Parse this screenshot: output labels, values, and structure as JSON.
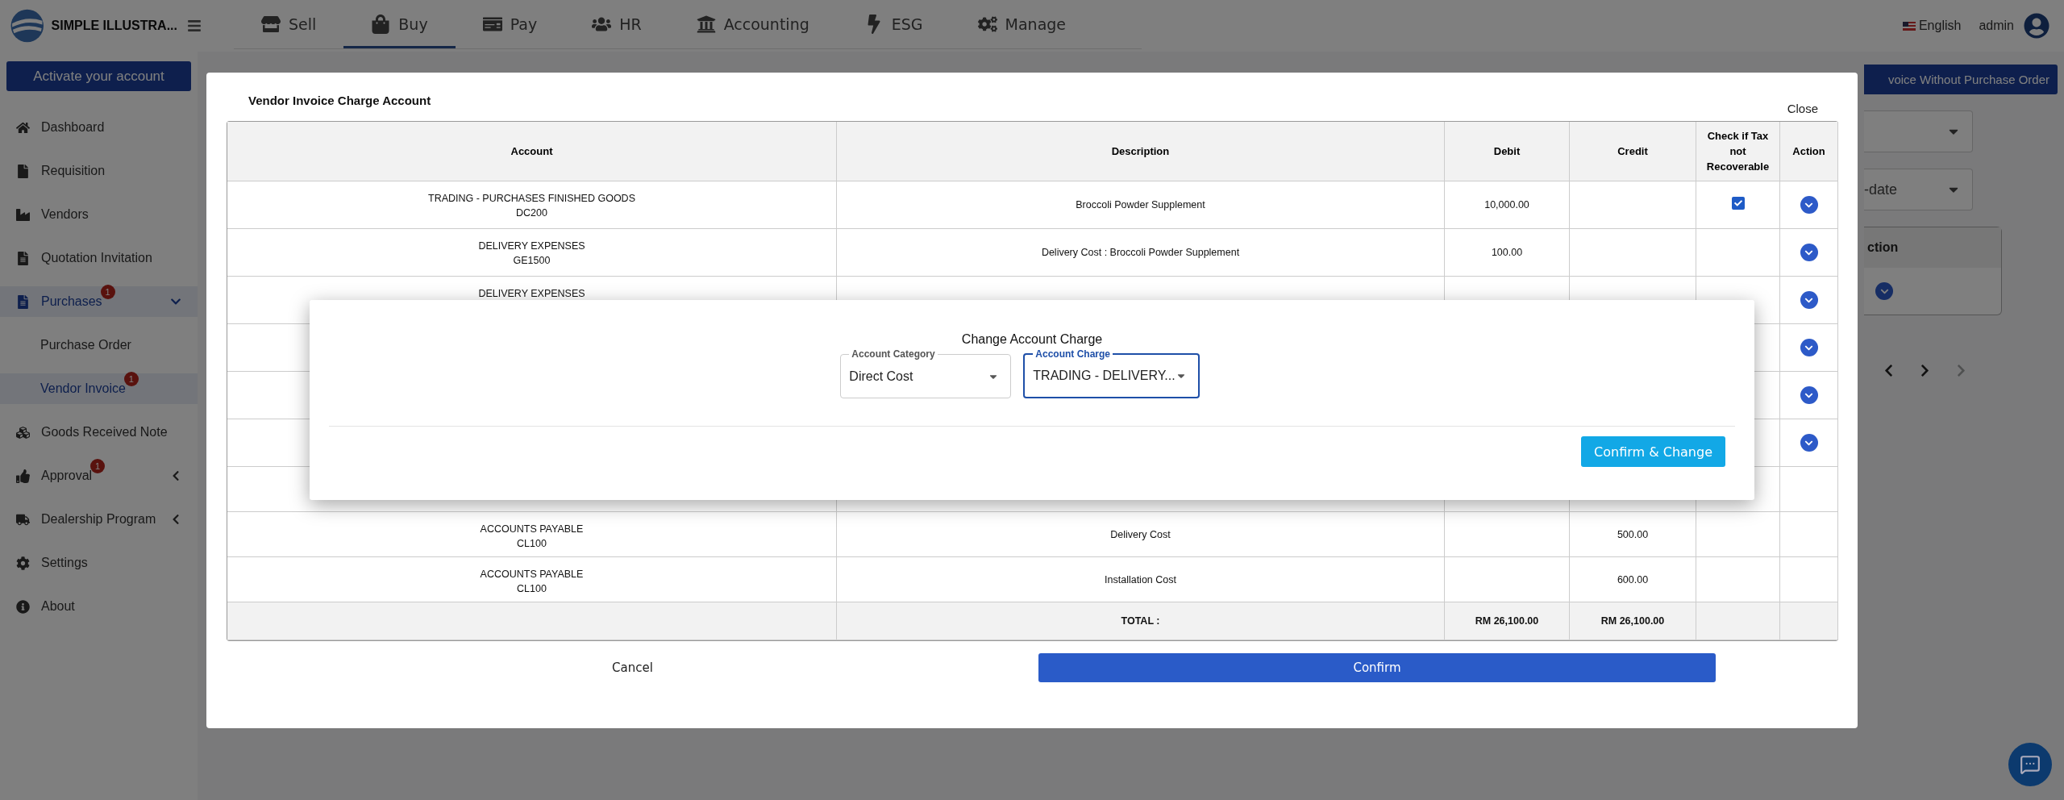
{
  "brand": {
    "name": "SIMPLE ILLUSTRA..."
  },
  "nav": [
    {
      "label": "Sell",
      "selected": false
    },
    {
      "label": "Buy",
      "selected": true
    },
    {
      "label": "Pay",
      "selected": false
    },
    {
      "label": "HR",
      "selected": false
    },
    {
      "label": "Accounting",
      "selected": false
    },
    {
      "label": "ESG",
      "selected": false
    },
    {
      "label": "Manage",
      "selected": false
    }
  ],
  "language": "English",
  "user": "admin",
  "activate_button": "Activate your account",
  "sidebar": {
    "items": [
      {
        "label": "Dashboard",
        "selected": false
      },
      {
        "label": "Requisition",
        "selected": false
      },
      {
        "label": "Vendors",
        "selected": false
      },
      {
        "label": "Quotation Invitation",
        "selected": false
      },
      {
        "label": "Purchases",
        "selected": true,
        "badge": "1",
        "expanded": true,
        "children": [
          {
            "label": "Purchase Order",
            "selected": false
          },
          {
            "label": "Vendor Invoice",
            "selected": true,
            "badge": "1"
          }
        ]
      },
      {
        "label": "Goods Received Note",
        "selected": false
      },
      {
        "label": "Approval",
        "selected": false,
        "badge": "1",
        "expanded": false
      },
      {
        "label": "Dealership Program",
        "selected": false,
        "expanded": false
      },
      {
        "label": "Settings",
        "selected": false
      },
      {
        "label": "About",
        "selected": false
      }
    ]
  },
  "background": {
    "action_button": "voice Without Purchase Order",
    "filter_value": "-date",
    "table_header": "ction"
  },
  "modal": {
    "title": "Vendor Invoice Charge Account",
    "close": "Close",
    "columns": [
      "Account",
      "Description",
      "Debit",
      "Credit",
      "Check if Tax not Recoverable",
      "Action"
    ],
    "rows": [
      {
        "account": "TRADING - PURCHASES FINISHED GOODS",
        "code": "DC200",
        "description": "Broccoli Powder Supplement",
        "debit": "10,000.00",
        "checked": true,
        "action": true
      },
      {
        "account": "DELIVERY EXPENSES",
        "code": "GE1500",
        "description": "Delivery Cost : Broccoli Powder Supplement",
        "debit": "100.00",
        "action": true
      },
      {
        "account": "DELIVERY EXPENSES",
        "action": true
      },
      {
        "action": true
      },
      {
        "action": true
      },
      {
        "action": true
      },
      {
        "action": false
      },
      {
        "account": "ACCOUNTS PAYABLE",
        "code": "CL100",
        "description": "Delivery Cost",
        "credit": "500.00",
        "action": false
      },
      {
        "account": "ACCOUNTS PAYABLE",
        "code": "CL100",
        "description": "Installation Cost",
        "credit": "600.00",
        "action": false
      }
    ],
    "total": {
      "label": "TOTAL :",
      "debit": "RM 26,100.00",
      "credit": "RM 26,100.00"
    },
    "cancel": "Cancel",
    "confirm": "Confirm"
  },
  "dialog": {
    "title": "Change Account Charge",
    "fields": [
      {
        "label": "Account Category",
        "value": "Direct Cost",
        "focused": false
      },
      {
        "label": "Account Charge",
        "value": "TRADING - DELIVERY...",
        "focused": true
      }
    ],
    "button": "Confirm & Change"
  }
}
